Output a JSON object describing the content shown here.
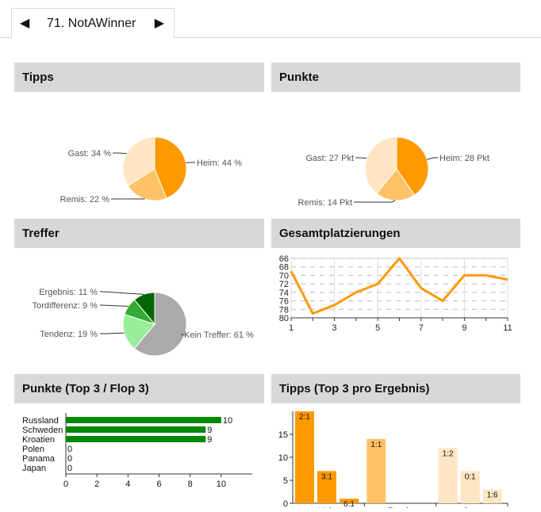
{
  "tab": {
    "title": "71. NotAWinner",
    "prev": "◀",
    "next": "▶"
  },
  "panels": {
    "tipps": {
      "title": "Tipps"
    },
    "punkte": {
      "title": "Punkte"
    },
    "treffer": {
      "title": "Treffer"
    },
    "gesamt": {
      "title": "Gesamtplatzierungen"
    },
    "topflop": {
      "title": "Punkte (Top 3 / Flop 3)"
    },
    "ergebnis": {
      "title": "Tipps (Top 3 pro Ergebnis)"
    }
  },
  "chart_data": [
    {
      "id": "tipps-pie",
      "type": "pie",
      "slices": [
        {
          "label": "Heim: 44 %",
          "value": 44,
          "color": "#ff9900"
        },
        {
          "label": "Remis: 22 %",
          "value": 22,
          "color": "#ffc266"
        },
        {
          "label": "Gast: 34 %",
          "value": 34,
          "color": "#ffe5c2"
        }
      ]
    },
    {
      "id": "punkte-pie",
      "type": "pie",
      "slices": [
        {
          "label": "Heim: 28 Pkt",
          "value": 28,
          "color": "#ff9900"
        },
        {
          "label": "Remis: 14 Pkt",
          "value": 14,
          "color": "#ffc266"
        },
        {
          "label": "Gast: 27 Pkt",
          "value": 27,
          "color": "#ffe5c2"
        }
      ]
    },
    {
      "id": "treffer-pie",
      "type": "pie",
      "slices": [
        {
          "label": "Kein Treffer: 61 %",
          "value": 61,
          "color": "#aaaaaa"
        },
        {
          "label": "Tendenz: 19 %",
          "value": 19,
          "color": "#99ee99"
        },
        {
          "label": "Tordifferenz: 9 %",
          "value": 9,
          "color": "#33aa33"
        },
        {
          "label": "Ergebnis: 11 %",
          "value": 11,
          "color": "#006600"
        }
      ]
    },
    {
      "id": "gesamt-line",
      "type": "line",
      "x": [
        1,
        2,
        3,
        4,
        5,
        6,
        7,
        8,
        9,
        10,
        11
      ],
      "y": [
        69,
        79,
        77,
        74,
        72,
        66,
        73,
        76,
        70,
        70,
        71
      ],
      "ylim": [
        80,
        66
      ],
      "yticks": [
        "66",
        "68",
        "70",
        "72",
        "74",
        "76",
        "78",
        "80"
      ],
      "xticks": [
        "1",
        "3",
        "5",
        "7",
        "9",
        "11"
      ],
      "color": "#ff9900",
      "grid": true
    },
    {
      "id": "topflop-bar",
      "type": "bar",
      "orientation": "horizontal",
      "categories": [
        "Russland",
        "Schweden",
        "Kroatien",
        "Polen",
        "Panama",
        "Japan"
      ],
      "values": [
        10,
        9,
        9,
        0,
        0,
        0
      ],
      "xlim": [
        0,
        12
      ],
      "xticks": [
        "0",
        "2",
        "4",
        "6",
        "8",
        "10"
      ],
      "color": "#008800"
    },
    {
      "id": "ergebnis-bar",
      "type": "bar",
      "groups": [
        {
          "name": "Heim",
          "bars": [
            {
              "label": "2:1",
              "value": 20,
              "color": "#ff9900"
            },
            {
              "label": "3:1",
              "value": 7,
              "color": "#ff9900"
            },
            {
              "label": "6:1",
              "value": 1,
              "color": "#ff9900"
            }
          ]
        },
        {
          "name": "Remis",
          "bars": [
            {
              "label": "1:1",
              "value": 14,
              "color": "#ffc266"
            }
          ]
        },
        {
          "name": "Gast",
          "bars": [
            {
              "label": "1:2",
              "value": 12,
              "color": "#ffe5c2"
            },
            {
              "label": "0:1",
              "value": 7,
              "color": "#ffe5c2"
            },
            {
              "label": "1:6",
              "value": 3,
              "color": "#ffe5c2"
            }
          ]
        }
      ],
      "ylim": [
        0,
        20
      ],
      "yticks": [
        "0",
        "5",
        "10",
        "15"
      ]
    }
  ]
}
